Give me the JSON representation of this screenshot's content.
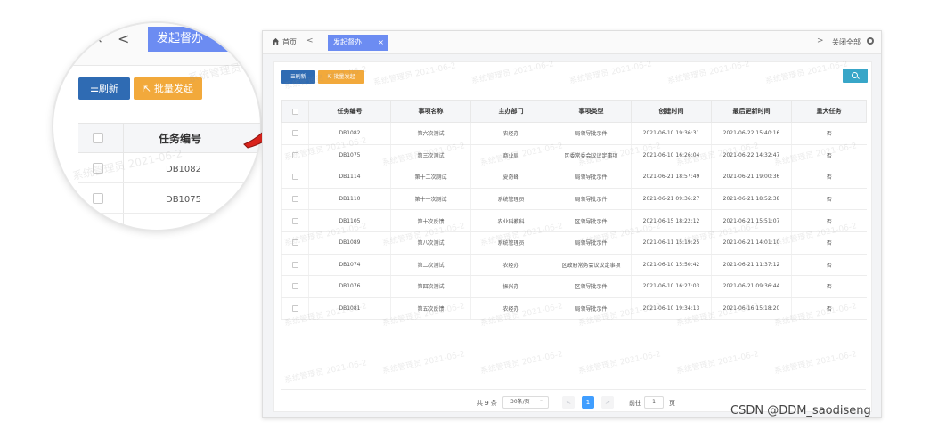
{
  "magnifier": {
    "close_glyph": "×",
    "prev_glyph": "<",
    "tab_label": "发起督办",
    "refresh_label": "☰刷新",
    "batch_label": "⇱ 批量发起",
    "column_header": "任务编号",
    "rows": [
      "DB1082",
      "DB1075"
    ],
    "watermark": "系统管理员 2021-06-2"
  },
  "tabbar": {
    "home_label": "首页",
    "prev_glyph": "<",
    "active_tab": "发起督办",
    "tab_close": "×",
    "next_glyph": ">",
    "close_all": "关闭全部"
  },
  "toolbar": {
    "refresh_label": "☰刷新",
    "batch_label": "⇱ 批量发起"
  },
  "table": {
    "columns": [
      "",
      "任务编号",
      "事项名称",
      "主办部门",
      "事项类型",
      "创建时间",
      "最后更新时间",
      "重大任务"
    ],
    "rows": [
      [
        "DB1082",
        "第六次测试",
        "农经办",
        "局领导批示件",
        "2021-06-10 19:36:31",
        "2021-06-22 15:40:16",
        "否"
      ],
      [
        "DB1075",
        "第三次测试",
        "商业局",
        "区委常委会议议定事项",
        "2021-06-10 16:26:04",
        "2021-06-22 14:32:47",
        "否"
      ],
      [
        "DB1114",
        "第十二次测试",
        "夏奇峰",
        "局领导批示件",
        "2021-06-21 18:57:49",
        "2021-06-21 19:00:36",
        "否"
      ],
      [
        "DB1110",
        "第十一次测试",
        "系统管理员",
        "局领导批示件",
        "2021-06-21 09:36:27",
        "2021-06-21 18:52:38",
        "否"
      ],
      [
        "DB1105",
        "第十次反馈",
        "农业科教科",
        "区领导批示件",
        "2021-06-15 18:22:12",
        "2021-06-21 15:51:07",
        "否"
      ],
      [
        "DB1089",
        "第八次测试",
        "系统管理员",
        "局领导批示件",
        "2021-06-11 15:19:25",
        "2021-06-21 14:01:10",
        "否"
      ],
      [
        "DB1074",
        "第二次测试",
        "农经办",
        "区政府常务会议议定事项",
        "2021-06-10 15:50:42",
        "2021-06-21 11:37:12",
        "否"
      ],
      [
        "DB1076",
        "第四次测试",
        "振兴办",
        "区领导批示件",
        "2021-06-10 16:27:03",
        "2021-06-21 09:36:44",
        "否"
      ],
      [
        "DB1081",
        "第五次反馈",
        "农经办",
        "局领导批示件",
        "2021-06-10 19:34:13",
        "2021-06-16 15:18:20",
        "否"
      ]
    ]
  },
  "watermark": "系统管理员 2021-06-2",
  "pager": {
    "total": "共 9 条",
    "page_size": "30条/页",
    "prev_glyph": "<",
    "current_page": "1",
    "next_glyph": ">",
    "goto_label": "前往",
    "goto_value": "1",
    "page_suffix": "页"
  },
  "credit": "CSDN @DDM_saodiseng",
  "colors": {
    "tab_active": "#6c8cf2",
    "refresh_button": "#2f6bb3",
    "batch_button": "#f2a93b",
    "search_button": "#38a6c8",
    "page_current": "#409eff",
    "arrow": "#d9231c"
  },
  "icons": {
    "home": "home-icon",
    "gear": "gear-icon",
    "search": "search-icon",
    "arrow": "red-curved-arrow"
  }
}
